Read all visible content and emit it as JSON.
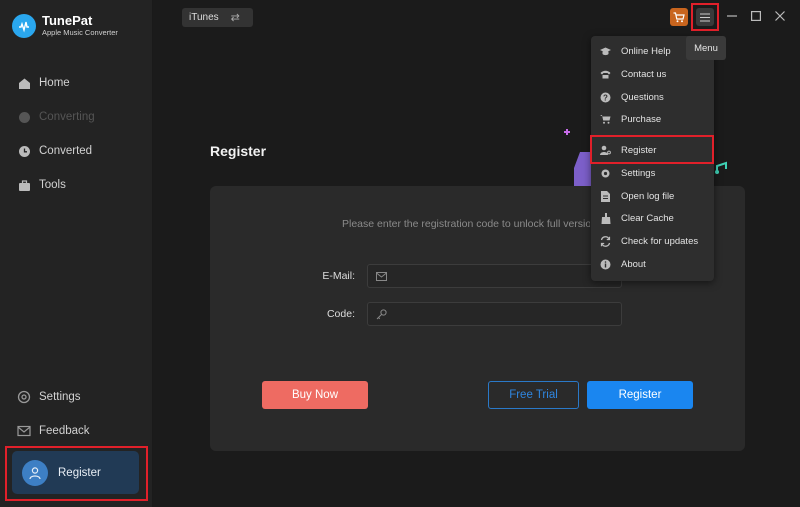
{
  "app": {
    "name": "TunePat",
    "subtitle": "Apple Music Converter"
  },
  "sidebar": {
    "items": [
      {
        "label": "Home",
        "icon": "home-icon"
      },
      {
        "label": "Converting",
        "icon": "converting-icon"
      },
      {
        "label": "Converted",
        "icon": "clock-icon"
      },
      {
        "label": "Tools",
        "icon": "toolbox-icon"
      }
    ],
    "bottom": [
      {
        "label": "Settings",
        "icon": "gear-icon"
      },
      {
        "label": "Feedback",
        "icon": "mail-icon"
      }
    ],
    "register_label": "Register"
  },
  "topbar": {
    "source": "iTunes",
    "tooltip": "Menu"
  },
  "main": {
    "title": "Register",
    "message": "Please enter the registration code to unlock full version.",
    "email_label": "E-Mail:",
    "code_label": "Code:",
    "email_value": "",
    "code_value": "",
    "buy_label": "Buy Now",
    "trial_label": "Free Trial",
    "register_label": "Register"
  },
  "menu": {
    "items": [
      {
        "label": "Online Help",
        "icon": "graduation-cap-icon"
      },
      {
        "label": "Contact us",
        "icon": "phone-icon"
      },
      {
        "label": "Questions",
        "icon": "question-icon"
      },
      {
        "label": "Purchase",
        "icon": "cart-icon"
      },
      {
        "label": "Register",
        "icon": "user-key-icon"
      },
      {
        "label": "Settings",
        "icon": "gear-icon"
      },
      {
        "label": "Open log file",
        "icon": "file-icon"
      },
      {
        "label": "Clear Cache",
        "icon": "broom-icon"
      },
      {
        "label": "Check for updates",
        "icon": "refresh-icon"
      },
      {
        "label": "About",
        "icon": "info-icon"
      }
    ]
  },
  "colors": {
    "accent": "#1a86f0",
    "buy": "#ee6b62",
    "highlight": "#e1202a"
  }
}
